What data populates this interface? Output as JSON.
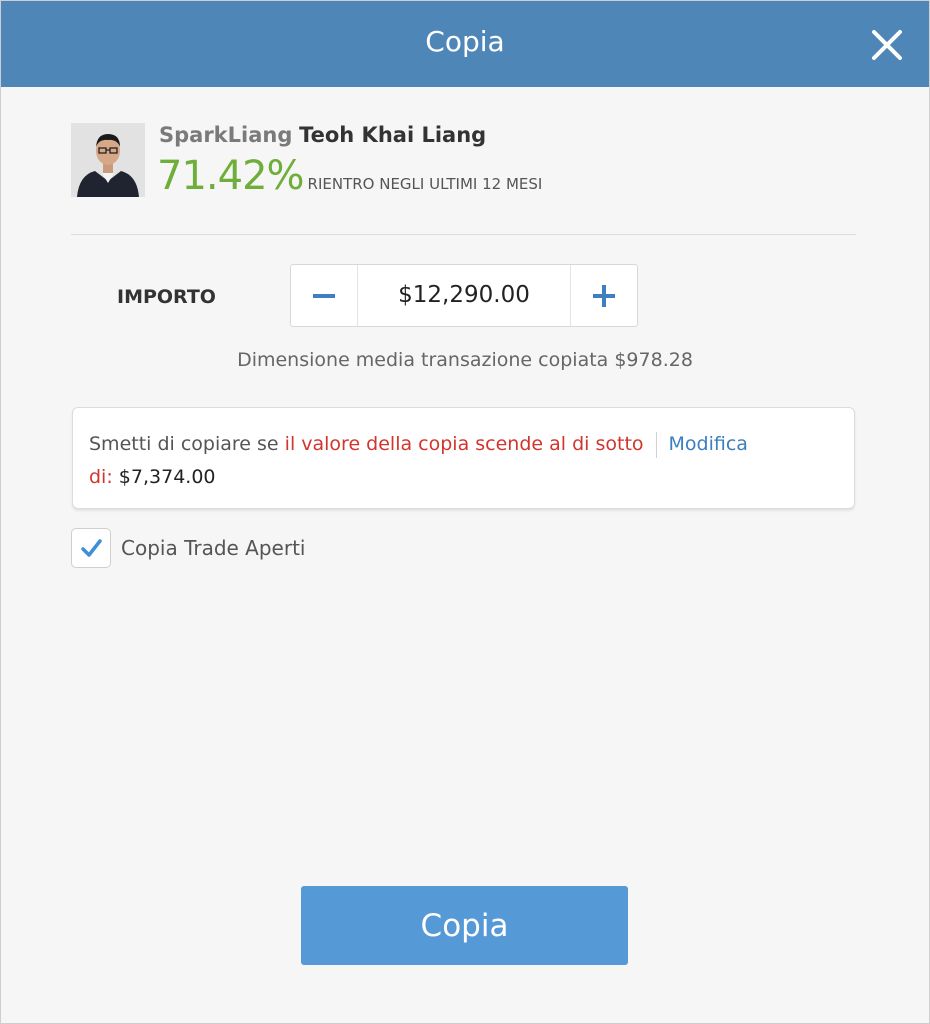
{
  "dialog": {
    "title": "Copia"
  },
  "trader": {
    "username": "SparkLiang",
    "full_name": "Teoh Khai Liang",
    "return_pct": "71.42%",
    "return_label": "RIENTRO NEGLI ULTIMI 12 MESI"
  },
  "amount": {
    "label": "IMPORTO",
    "value": "$12,290.00"
  },
  "avg_trade": "Dimensione media transazione copiata $978.28",
  "stop_loss": {
    "prefix": "Smetti di copiare se ",
    "highlight_1": "il valore della copia scende al di sotto",
    "highlight_2": "di:",
    "value": "$7,374.00",
    "edit_label": "Modifica"
  },
  "copy_open_trades": {
    "label": "Copia Trade Aperti",
    "checked": true
  },
  "primary_button": "Copia",
  "colors": {
    "header": "#4f86b8",
    "gain": "#6fae3a",
    "warning": "#d2352d",
    "link": "#3b7fbf",
    "button": "#5599d6"
  },
  "icons": [
    "close-icon",
    "avatar-photo",
    "minus-icon",
    "plus-icon",
    "checkmark-icon"
  ]
}
